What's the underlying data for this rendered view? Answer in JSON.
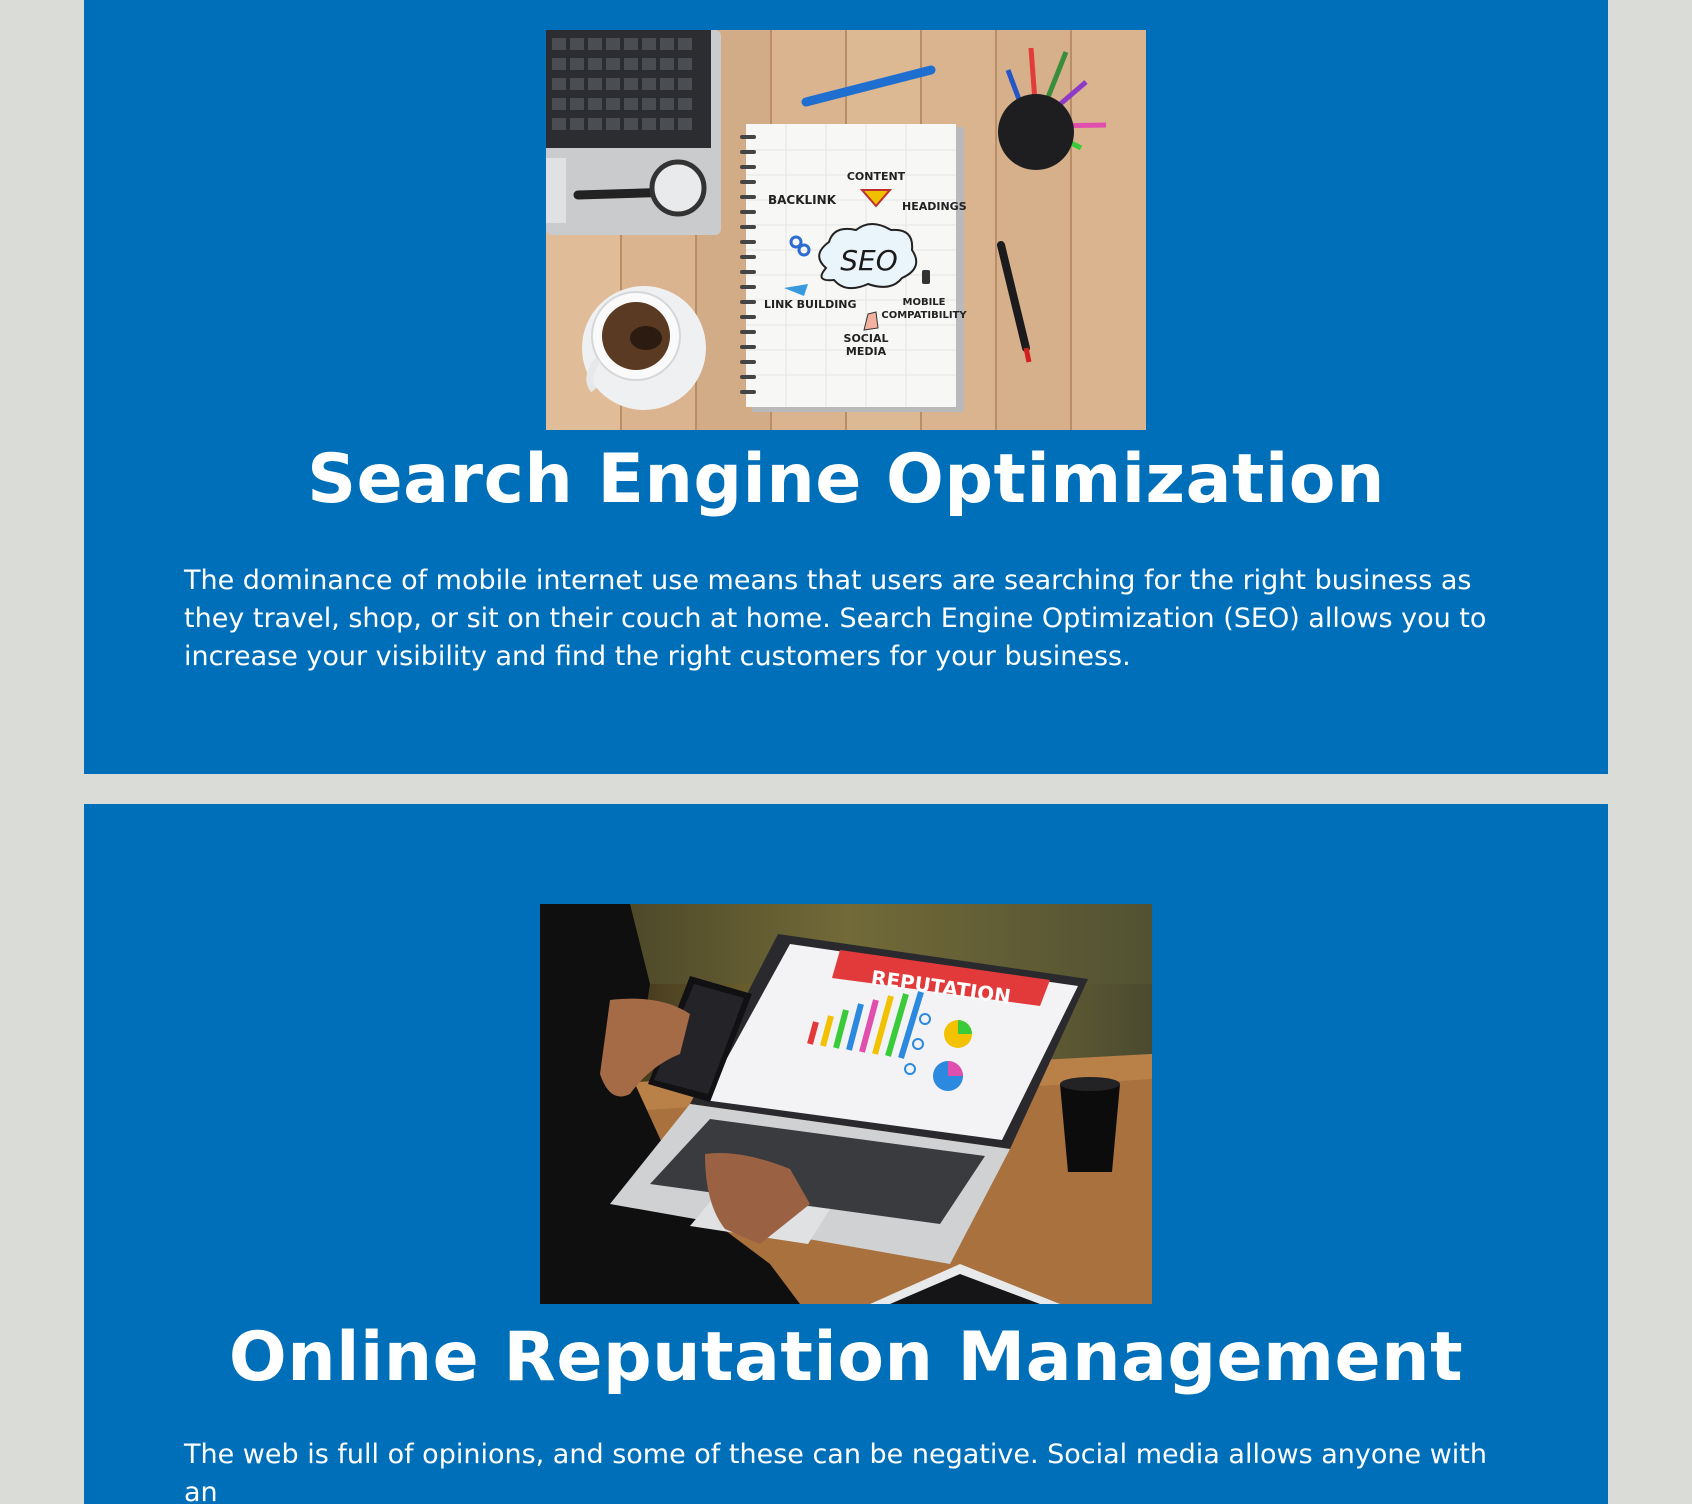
{
  "sections": [
    {
      "title": "Search Engine Optimization",
      "body": "The dominance of mobile internet use means that users are searching for the right business as they travel, shop, or sit on their couch at home. Search Engine Optimization (SEO) allows you to increase your visibility and find the right customers for your business.",
      "notebook": {
        "center": "SEO",
        "content": "CONTENT",
        "backlink": "BACKLINK",
        "headings": "HEADINGS",
        "link_building": "LINK BUILDING",
        "mobile": "MOBILE",
        "compatibility": "COMPATIBILITY",
        "social": "SOCIAL",
        "media": "MEDIA"
      }
    },
    {
      "title": "Online Reputation Management",
      "body": "The web is full of opinions, and some of these can be negative. Social media allows anyone with an",
      "screen_banner": "REPUTATION"
    }
  ],
  "colors": {
    "page_background": "#dadcd7",
    "card_background": "#006fba",
    "text": "#ffffff"
  }
}
